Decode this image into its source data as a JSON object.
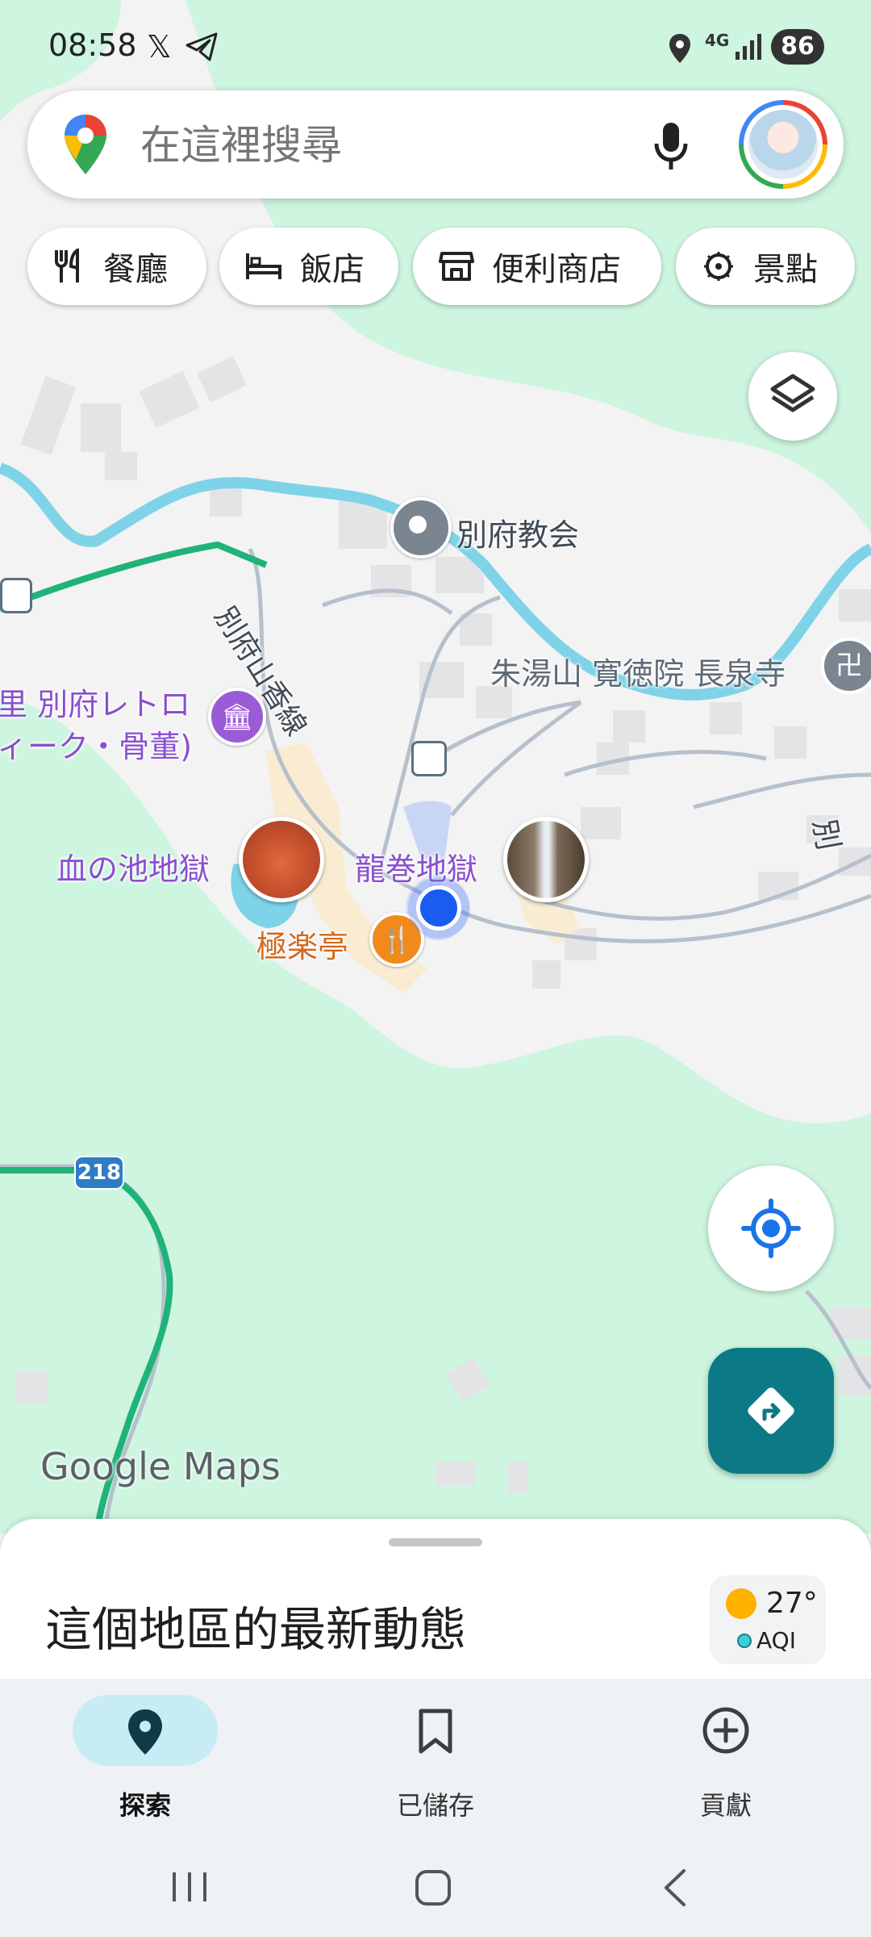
{
  "status_bar": {
    "time": "08:58",
    "network": "4G",
    "battery": "86"
  },
  "search": {
    "placeholder": "在這裡搜尋"
  },
  "categories": [
    {
      "label": "餐廳",
      "icon": "restaurant-icon"
    },
    {
      "label": "飯店",
      "icon": "hotel-icon"
    },
    {
      "label": "便利商店",
      "icon": "store-icon"
    },
    {
      "label": "景點",
      "icon": "attraction-icon"
    }
  ],
  "map": {
    "labels": {
      "church": "別府教会",
      "road": "別府山香線",
      "temple": "朱湯山 寛徳院 長泉寺",
      "museum_line1": "里 別府レトロ",
      "museum_line2": "ィーク・骨董)",
      "chinoike": "血の池地獄",
      "tatsumaki": "龍巻地獄",
      "gokurakutei": "極楽亭",
      "route_shield": "218",
      "edge_label": "別"
    },
    "watermark": "Google Maps",
    "colors": {
      "water": "#7fd3e8",
      "park": "#cdf5df",
      "route": "#1fb37a",
      "directions_button": "#0b7a86",
      "poi_purple": "#9b5bd6",
      "poi_orange": "#f08a1c"
    }
  },
  "sheet": {
    "title": "這個地區的最新動態",
    "weather_temp": "27°",
    "aqi_label": "AQI"
  },
  "bottom_nav": [
    {
      "label": "探索",
      "icon": "explore-pin-icon",
      "active": true
    },
    {
      "label": "已儲存",
      "icon": "bookmark-icon",
      "active": false
    },
    {
      "label": "貢獻",
      "icon": "add-circle-icon",
      "active": false
    }
  ]
}
